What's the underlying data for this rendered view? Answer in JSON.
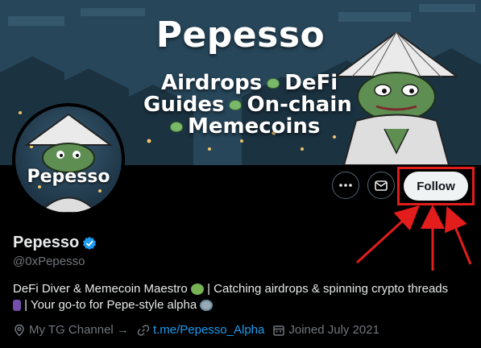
{
  "banner": {
    "title": "Pepesso",
    "line1_a": "Airdrops",
    "line1_b": "DeFi",
    "line2_a": "Guides",
    "line2_b": "On-chain",
    "line3": "Memecoins"
  },
  "avatar": {
    "label": "Pepesso"
  },
  "actions": {
    "more_icon": "more-icon",
    "message_icon": "envelope-icon",
    "follow_label": "Follow"
  },
  "profile": {
    "display_name": "Pepesso",
    "handle": "@0xPepesso",
    "bio_line1": "DeFi Diver & Memecoin Maestro",
    "bio_line1_rest": "| Catching airdrops & spinning crypto threads",
    "bio_line2": "| Your go-to for Pepe-style alpha",
    "location": "My TG Channel →",
    "website": "t.me/Pepesso_Alpha",
    "joined": "Joined July 2021"
  },
  "colors": {
    "accent": "#1d9bf0",
    "highlight": "#e31c1c",
    "muted": "#71767b"
  }
}
